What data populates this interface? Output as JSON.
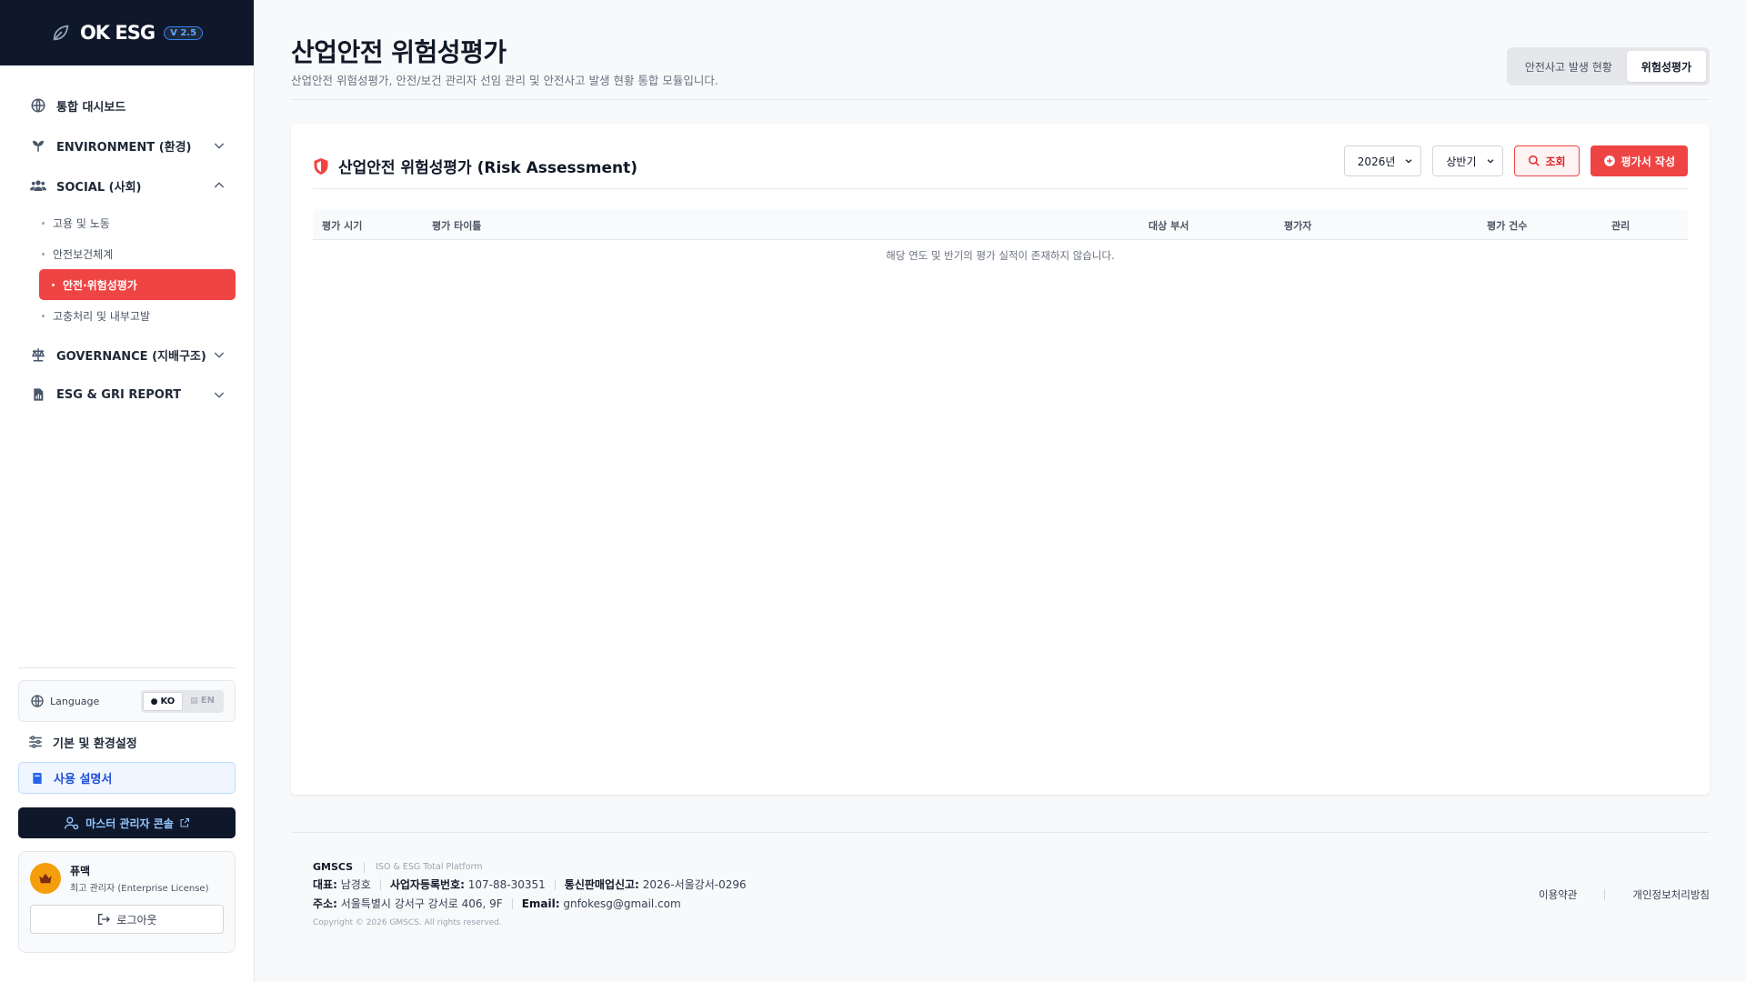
{
  "brand": {
    "name": "OK ESG",
    "version": "V 2.5"
  },
  "sidebar": {
    "items": [
      {
        "label": "통합 대시보드"
      },
      {
        "label": "ENVIRONMENT (환경)"
      },
      {
        "label": "SOCIAL (사회)"
      },
      {
        "label": "GOVERNANCE (지배구조)"
      },
      {
        "label": "ESG & GRI REPORT"
      }
    ],
    "social_sub": [
      {
        "label": "고용 및 노동"
      },
      {
        "label": "안전보건체계"
      },
      {
        "label": "안전·위험성평가"
      },
      {
        "label": "고충처리 및 내부고발"
      }
    ],
    "language": {
      "label": "Language",
      "ko": "KO",
      "en": "EN",
      "selected": "KO"
    },
    "settings_label": "기본 및 환경설정",
    "manual_label": "사용 설명서",
    "master_label": "마스터 관리자 콘솔",
    "profile": {
      "name": "퓨맥",
      "role": "최고 관리자 (Enterprise License)",
      "logout": "로그아웃"
    }
  },
  "header": {
    "title": "산업안전 위험성평가",
    "subtitle": "산업안전 위험성평가, 안전/보건 관리자 선임 관리 및 안전사고 발생 현황 통합 모듈입니다.",
    "tabs": [
      {
        "label": "안전사고 발생 현황"
      },
      {
        "label": "위험성평가"
      }
    ]
  },
  "card": {
    "title": "산업안전 위험성평가 (Risk Assessment)",
    "year_select": "2026년",
    "half_select": "상반기",
    "search_label": "조회",
    "write_label": "평가서 작성",
    "columns": [
      "평가 시기",
      "평가 타이틀",
      "대상 부서",
      "평가자",
      "평가 건수",
      "관리"
    ],
    "empty_message": "해당 연도 및 반기의 평가 실적이 존재하지 않습니다."
  },
  "footer": {
    "company": "GMSCS",
    "tagline": "ISO & ESG Total Platform",
    "ceo_label": "대표:",
    "ceo": "남경호",
    "bizno_label": "사업자등록번호:",
    "bizno": "107-88-30351",
    "mail_order_label": "통신판매업신고:",
    "mail_order": "2026-서울강서-0296",
    "address_label": "주소:",
    "address": "서울특별시 강서구 강서로 406, 9F",
    "email_label": "Email:",
    "email": "gnfokesg@gmail.com",
    "copyright": "Copyright © 2026 GMSCS. All rights reserved.",
    "terms": "이용약관",
    "privacy": "개인정보처리방침"
  },
  "colors": {
    "accent": "#ef4444",
    "dark": "#0f172a",
    "link_blue": "#1d4ed8"
  }
}
